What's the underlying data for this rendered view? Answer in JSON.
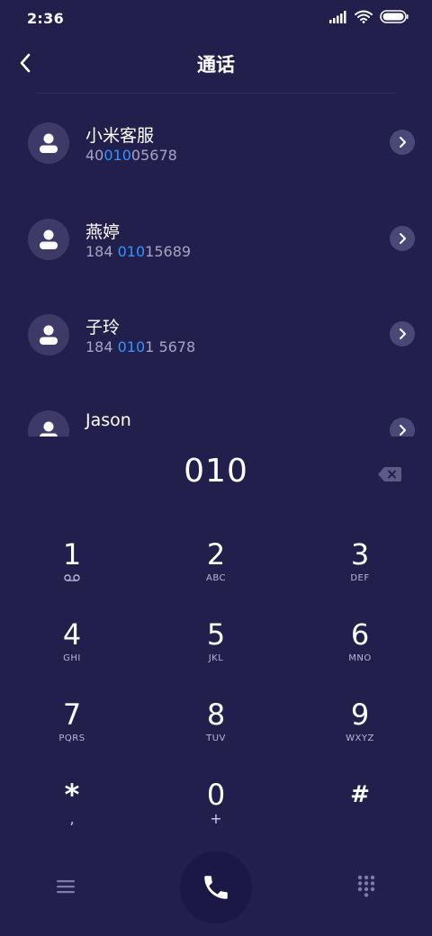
{
  "status_bar": {
    "time": "2:36",
    "icons": [
      "signal-icon",
      "wifi-icon",
      "battery-icon"
    ]
  },
  "header": {
    "title": "通话",
    "back_icon": "chevron-left-icon"
  },
  "contacts": [
    {
      "name": "小米客服",
      "number_pre": "40",
      "number_match": "010",
      "number_post": "05678"
    },
    {
      "name": "燕婷",
      "number_pre": "184 ",
      "number_match": "010",
      "number_post": "15689"
    },
    {
      "name": "子玲",
      "number_pre": "184 ",
      "number_match": "010",
      "number_post": "1 5678"
    },
    {
      "name": "Jason",
      "number_pre": "",
      "number_match": "",
      "number_post": ""
    }
  ],
  "dialed": {
    "number": "010"
  },
  "keypad": [
    {
      "digit": "1",
      "letters": ""
    },
    {
      "digit": "2",
      "letters": "ABC"
    },
    {
      "digit": "3",
      "letters": "DEF"
    },
    {
      "digit": "4",
      "letters": "GHI"
    },
    {
      "digit": "5",
      "letters": "JKL"
    },
    {
      "digit": "6",
      "letters": "MNO"
    },
    {
      "digit": "7",
      "letters": "PQRS"
    },
    {
      "digit": "8",
      "letters": "TUV"
    },
    {
      "digit": "9",
      "letters": "WXYZ"
    },
    {
      "digit": "*",
      "letters": ","
    },
    {
      "digit": "0",
      "letters": "+"
    },
    {
      "digit": "#",
      "letters": ""
    }
  ],
  "colors": {
    "background": "#231f4d",
    "highlight": "#2f95ff",
    "secondary_text": "#a6a4c4",
    "avatar_bg": "#3d3a68",
    "call_button_bg": "#1b1845"
  }
}
